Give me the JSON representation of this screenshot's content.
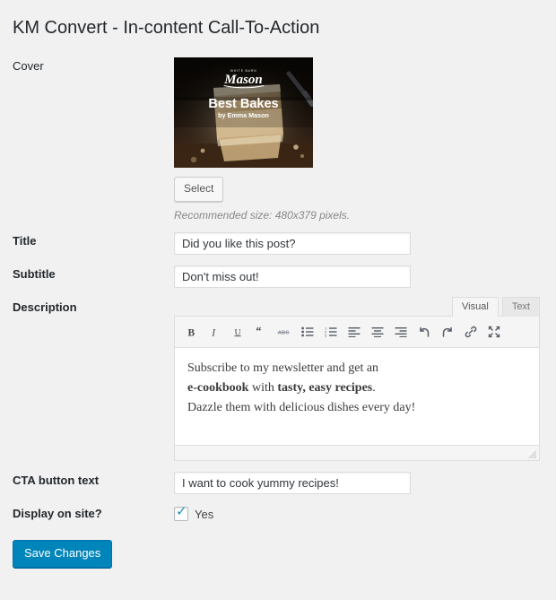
{
  "page": {
    "title": "KM Convert - In-content Call-To-Action"
  },
  "fields": {
    "cover": {
      "label": "Cover",
      "select_button": "Select",
      "recommended": "Recommended size: 480x379 pixels.",
      "image": {
        "brand_small": "WHITE BARN",
        "brand": "Mason",
        "headline": "Best Bakes",
        "byline": "by Emma Mason"
      }
    },
    "title": {
      "label": "Title",
      "value": "Did you like this post?",
      "placeholder": ""
    },
    "subtitle": {
      "label": "Subtitle",
      "value": "Don't miss out!",
      "placeholder": ""
    },
    "description": {
      "label": "Description",
      "tabs": [
        {
          "label": "Visual",
          "active": true
        },
        {
          "label": "Text",
          "active": false
        }
      ],
      "toolbar": [
        {
          "name": "bold-icon",
          "title": "Bold"
        },
        {
          "name": "italic-icon",
          "title": "Italic"
        },
        {
          "name": "underline-icon",
          "title": "Underline"
        },
        {
          "name": "blockquote-icon",
          "title": "Blockquote"
        },
        {
          "name": "strikethrough-icon",
          "title": "Strikethrough"
        },
        {
          "name": "unordered-list-icon",
          "title": "Bulleted list"
        },
        {
          "name": "ordered-list-icon",
          "title": "Numbered list"
        },
        {
          "name": "align-left-icon",
          "title": "Align left"
        },
        {
          "name": "align-center-icon",
          "title": "Align center"
        },
        {
          "name": "align-right-icon",
          "title": "Align right"
        },
        {
          "name": "undo-icon",
          "title": "Undo"
        },
        {
          "name": "redo-icon",
          "title": "Redo"
        },
        {
          "name": "link-icon",
          "title": "Insert/edit link"
        },
        {
          "name": "fullscreen-icon",
          "title": "Fullscreen"
        }
      ],
      "content_lines": [
        {
          "parts": [
            {
              "text": "Subscribe to my newsletter and get an",
              "bold": false
            }
          ]
        },
        {
          "parts": [
            {
              "text": "e-cookbook",
              "bold": true
            },
            {
              "text": " with ",
              "bold": false
            },
            {
              "text": "tasty, easy recipes",
              "bold": true
            },
            {
              "text": ".",
              "bold": false
            }
          ]
        },
        {
          "parts": [
            {
              "text": "Dazzle them with delicious dishes every day!",
              "bold": false
            }
          ]
        }
      ]
    },
    "cta_button_text": {
      "label": "CTA button text",
      "value": "I want to cook yummy recipes!",
      "placeholder": ""
    },
    "display_on_site": {
      "label": "Display on site?",
      "checkbox_label": "Yes",
      "checked": true,
      "check_glyph": "✓"
    }
  },
  "actions": {
    "save": "Save Changes"
  },
  "colors": {
    "accent": "#0085ba",
    "background": "#f1f1f1",
    "text": "#23282d",
    "muted": "#888888"
  }
}
